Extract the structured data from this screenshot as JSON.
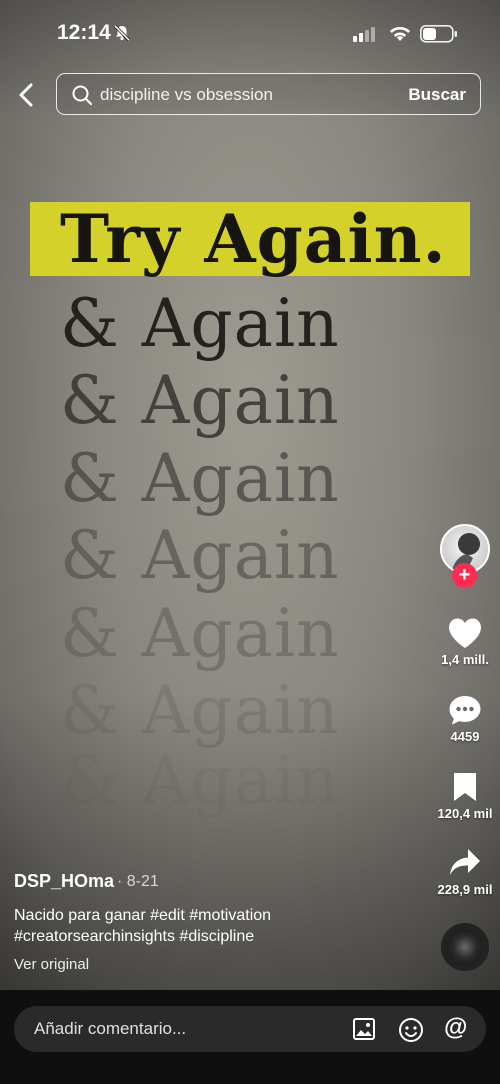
{
  "status_bar": {
    "time": "12:14"
  },
  "search": {
    "query": "discipline vs obsession",
    "button_label": "Buscar"
  },
  "video_text": {
    "headline": "Try Again.",
    "lines": [
      "& Again",
      "& Again",
      "& Again",
      "& Again",
      "& Again",
      "& Again",
      "& Again"
    ]
  },
  "actions": {
    "likes": "1,4 mill.",
    "comments": "4459",
    "saves": "120,4 mil",
    "shares": "228,9 mil"
  },
  "post": {
    "author": "DSP_HOma",
    "date": "· 8-21",
    "caption": "Nacido para ganar #edit #motivation #creatorsearchinsights #discipline",
    "view_original": "Ver original"
  },
  "comment_bar": {
    "placeholder": "Añadir comentario..."
  },
  "colors": {
    "highlight": "#d4d12a",
    "follow_badge": "#fe2c55",
    "bottom_bar": "#0f0f0f"
  }
}
